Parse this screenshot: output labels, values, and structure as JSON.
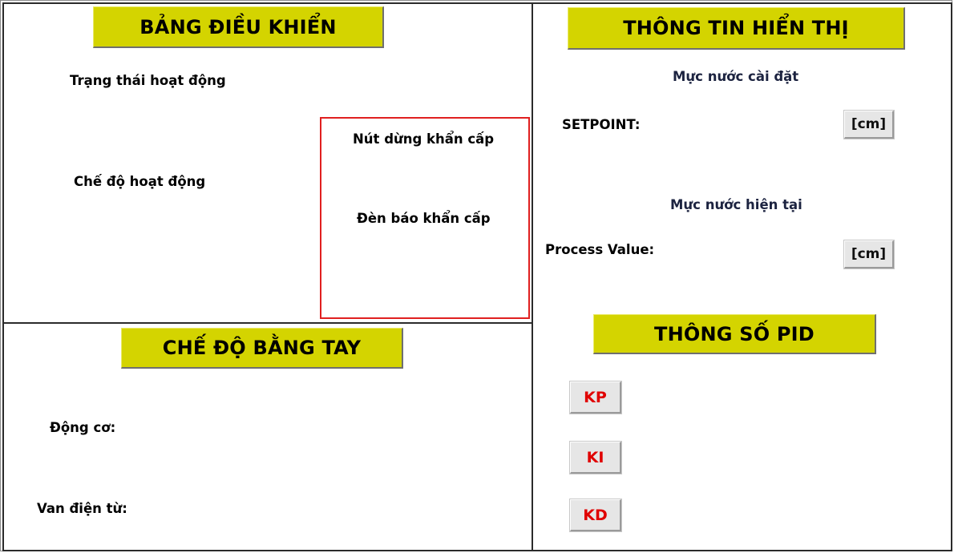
{
  "control_panel": {
    "title": "BẢNG ĐIỀU KHIỂN",
    "status_label": "Trạng thái hoạt động",
    "mode_label": "Chế độ hoạt động",
    "emergency": {
      "stop_button_label": "Nút dừng khẩn cấp",
      "lamp_label": "Đèn báo khẩn cấp"
    }
  },
  "manual_panel": {
    "title": "CHẾ ĐỘ BẰNG TAY",
    "motor_label": "Động cơ:",
    "valve_label": "Van điện từ:"
  },
  "display_panel": {
    "title": "THÔNG TIN HIỂN THỊ",
    "setpoint_heading": "Mực nước cài đặt",
    "setpoint_label": "SETPOINT:",
    "setpoint_unit": "[cm]",
    "pv_heading": "Mực nước hiện tại",
    "pv_label": "Process Value:",
    "pv_unit": "[cm]"
  },
  "pid_panel": {
    "title": "THÔNG SỐ PID",
    "kp_label": "KP",
    "ki_label": "KI",
    "kd_label": "KD"
  },
  "colors": {
    "banner": "#d4d400",
    "emergency_border": "#e02020",
    "pid_text": "#e00000"
  }
}
